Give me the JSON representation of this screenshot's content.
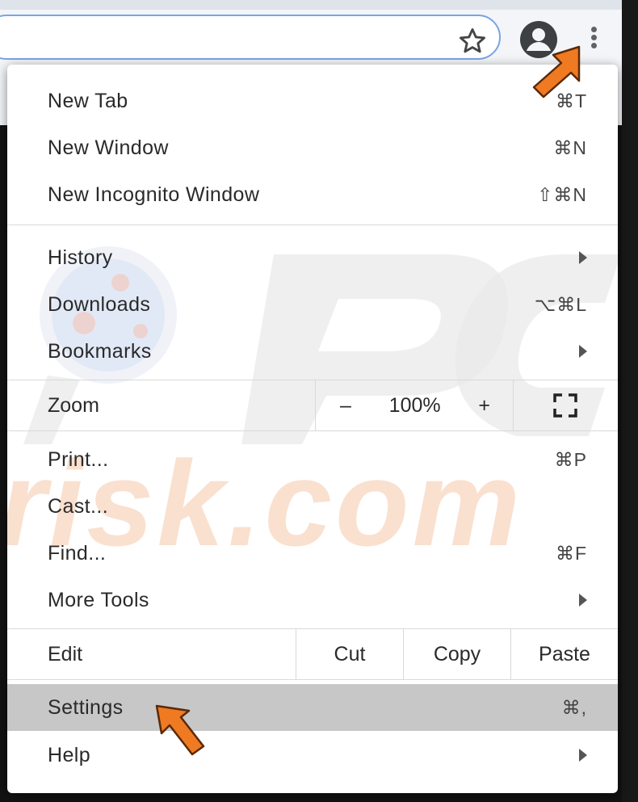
{
  "browser": {
    "toolbar_icons": [
      "star-icon",
      "avatar-icon",
      "kebab-menu-icon"
    ]
  },
  "menu": {
    "group1": [
      {
        "label": "New Tab",
        "shortcut": "⌘T"
      },
      {
        "label": "New Window",
        "shortcut": "⌘N"
      },
      {
        "label": "New Incognito Window",
        "shortcut": "⇧⌘N"
      }
    ],
    "group2": [
      {
        "label": "History",
        "submenu": true
      },
      {
        "label": "Downloads",
        "shortcut": "⌥⌘L"
      },
      {
        "label": "Bookmarks",
        "submenu": true
      }
    ],
    "zoom": {
      "label": "Zoom",
      "minus": "–",
      "value": "100%",
      "plus": "+",
      "fullscreen_icon": "fullscreen-icon"
    },
    "group3": [
      {
        "label": "Print...",
        "shortcut": "⌘P"
      },
      {
        "label": "Cast..."
      },
      {
        "label": "Find...",
        "shortcut": "⌘F"
      },
      {
        "label": "More Tools",
        "submenu": true
      }
    ],
    "edit": {
      "label": "Edit",
      "cut": "Cut",
      "copy": "Copy",
      "paste": "Paste"
    },
    "group4": [
      {
        "label": "Settings",
        "shortcut": "⌘,",
        "highlighted": true
      },
      {
        "label": "Help",
        "submenu": true
      }
    ]
  },
  "watermark": {
    "text_top": "PC",
    "text_bottom": "risk.com"
  },
  "colors": {
    "highlight": "#c7c7c7",
    "pointer_arrow": "#f07a22",
    "omnibox_border": "#7aa3e6"
  }
}
